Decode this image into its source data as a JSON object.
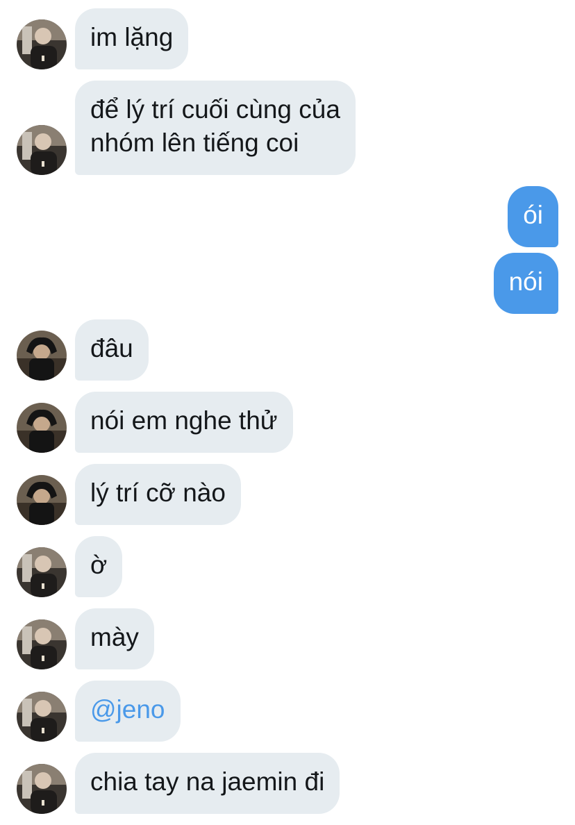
{
  "conversation": {
    "messages": [
      {
        "side": "in",
        "avatar": "avatar-a",
        "text": "im lặng"
      },
      {
        "side": "in",
        "avatar": "avatar-a",
        "line1": "để lý trí cuối cùng của",
        "line2": "nhóm lên tiếng coi"
      },
      {
        "side": "out",
        "text": "ói"
      },
      {
        "side": "out",
        "text": "nói"
      },
      {
        "side": "in",
        "avatar": "avatar-b",
        "text": "đâu"
      },
      {
        "side": "in",
        "avatar": "avatar-b",
        "text": "nói em nghe thử"
      },
      {
        "side": "in",
        "avatar": "avatar-b",
        "text": "lý trí cỡ nào"
      },
      {
        "side": "in",
        "avatar": "avatar-a",
        "text": "ờ"
      },
      {
        "side": "in",
        "avatar": "avatar-a",
        "text": "mày"
      },
      {
        "side": "in",
        "avatar": "avatar-a",
        "text": "@jeno",
        "is_mention": true
      },
      {
        "side": "in",
        "avatar": "avatar-a",
        "text": "chia tay na jaemin đi"
      }
    ]
  },
  "colors": {
    "incoming_bubble": "#e6ecf0",
    "outgoing_bubble": "#4a99e9",
    "mention": "#4a99e9",
    "text": "#14171a"
  }
}
